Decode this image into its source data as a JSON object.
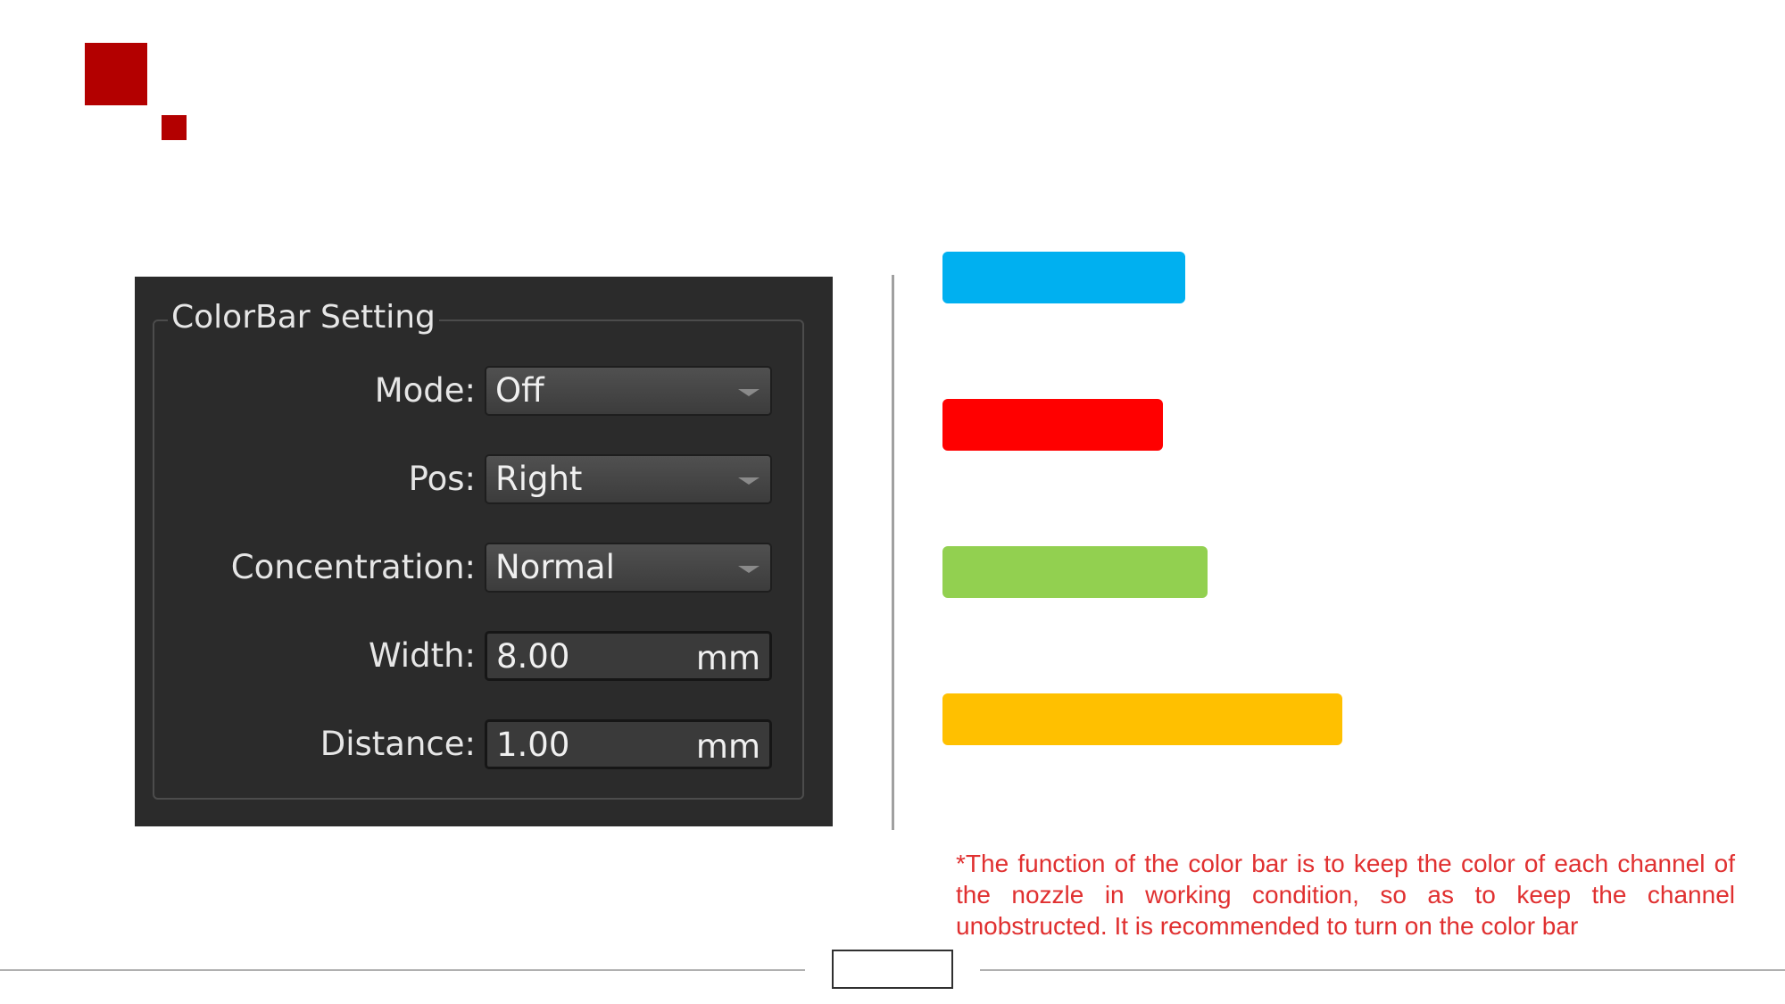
{
  "logo": {
    "color": "#b30000"
  },
  "colorbar_setting": {
    "title": "ColorBar Setting",
    "fields": [
      {
        "label": "Mode:",
        "value": "Off",
        "type": "select"
      },
      {
        "label": "Pos:",
        "value": "Right",
        "type": "select"
      },
      {
        "label": "Concentration:",
        "value": "Normal",
        "type": "select"
      },
      {
        "label": "Width:",
        "value": "8.00",
        "unit": "mm",
        "type": "spinbox"
      },
      {
        "label": "Distance:",
        "value": "1.00",
        "unit": "mm",
        "type": "spinbox"
      }
    ]
  },
  "color_bars": [
    {
      "color": "#00b0f0"
    },
    {
      "color": "#ff0000"
    },
    {
      "color": "#92d050"
    },
    {
      "color": "#ffc000"
    }
  ],
  "note": "*The function of the color bar is to keep the color of each channel of the nozzle in working condition, so as to keep the channel unobstructed. It is recommended to turn on the color bar"
}
